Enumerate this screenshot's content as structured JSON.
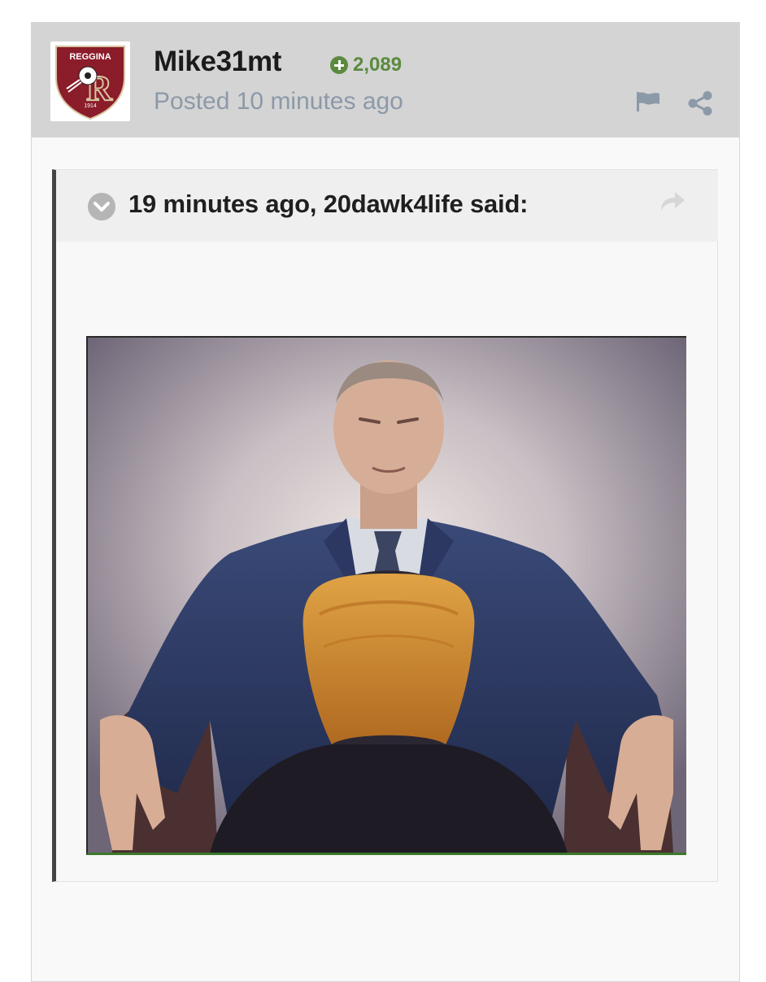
{
  "post": {
    "avatar": {
      "club_name": "REGGINA",
      "year": "1914",
      "brand_color": "#8b1c2a"
    },
    "author": "Mike31mt",
    "reputation": "2,089",
    "reputation_icon": "plus-circle-icon",
    "posted": "Posted 10 minutes ago",
    "actions": [
      {
        "icon": "flag-icon"
      },
      {
        "icon": "share-icon"
      }
    ]
  },
  "quote": {
    "citation": "19 minutes ago, 20dawk4life said:",
    "toggle_icon": "chevron-down-icon",
    "reply_icon": "reply-arrow-icon",
    "image_icon": "photo"
  },
  "colors": {
    "header_bg": "#d4d4d4",
    "rep_green": "#5b8a3e",
    "muted_text": "#8c99a8",
    "quote_border": "#444444"
  }
}
